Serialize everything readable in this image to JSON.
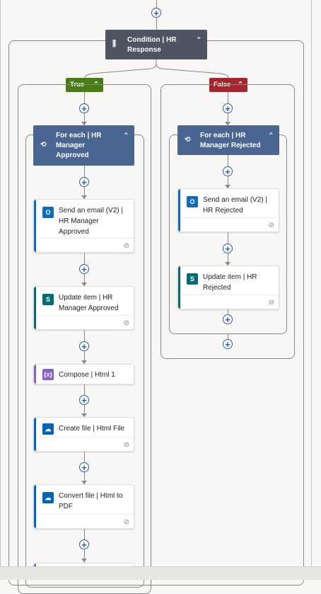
{
  "condition": {
    "title": "Condition | HR Response"
  },
  "branches": {
    "true_label": "True",
    "false_label": "False"
  },
  "true_branch": {
    "loop_title": "For each | HR Manager Approved",
    "actions": [
      {
        "label": "Send an email (V2) | HR Manager Approved",
        "icon": "outlook-icon"
      },
      {
        "label": "Update item | HR Manager Approved",
        "icon": "sharepoint-icon"
      },
      {
        "label": "Compose | Html 1",
        "icon": "compose-icon"
      },
      {
        "label": "Create file | Html File",
        "icon": "onedrive-icon"
      },
      {
        "label": "Convert file | Html to PDF",
        "icon": "onedrive-icon"
      }
    ]
  },
  "false_branch": {
    "loop_title": "For each | HR Manager Rejected",
    "actions": [
      {
        "label": "Send an email (V2) | HR Rejected",
        "icon": "outlook-icon"
      },
      {
        "label": "Update item | HR Rejected",
        "icon": "sharepoint-icon"
      }
    ]
  },
  "symbols": {
    "plus": "+",
    "chevron_up": "⌃",
    "link": "⊘",
    "loop": "⟲",
    "condition": "⫼"
  },
  "colors": {
    "loop_header": "#4a6592",
    "condition_header": "#4d5563",
    "true_badge": "#4a7c14",
    "false_badge": "#a4262c",
    "outlook": "#0f6cbd",
    "sharepoint": "#036c70",
    "compose": "#8661c5",
    "onedrive": "#0364b8"
  }
}
